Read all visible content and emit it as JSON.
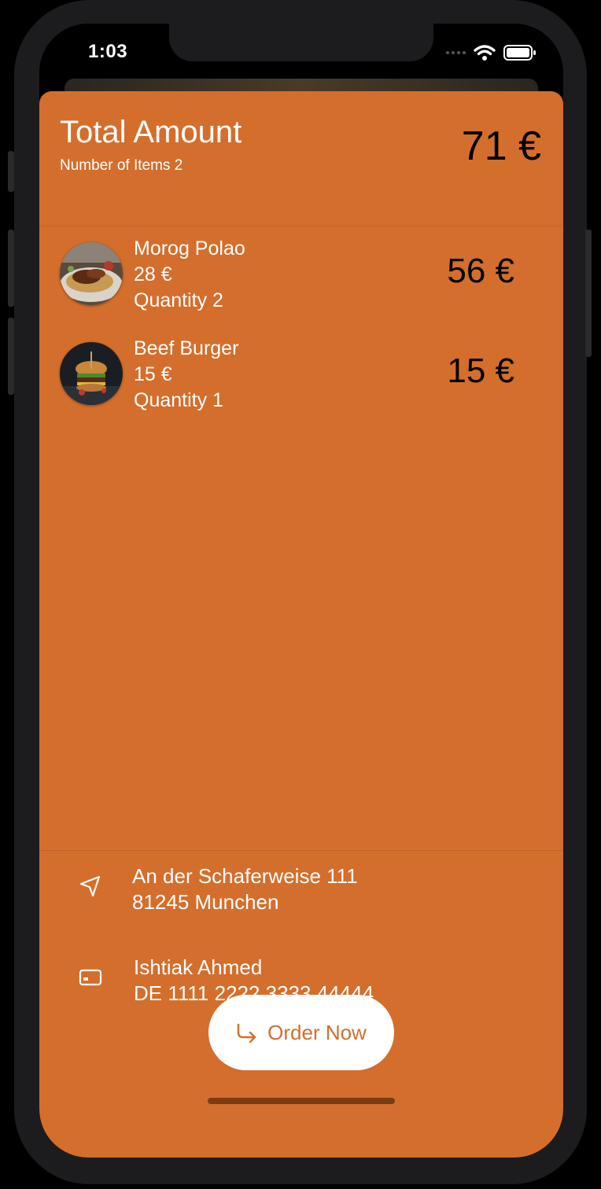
{
  "status_bar": {
    "time": "1:03"
  },
  "header": {
    "title": "Total Amount",
    "items_count": "Number of Items 2",
    "total": "71 €"
  },
  "cart_items": [
    {
      "name": "Morog Polao",
      "unit_price": "28 €",
      "quantity": "Quantity 2",
      "line_total": "56 €",
      "image": "rice-dish-photo"
    },
    {
      "name": "Beef Burger",
      "unit_price": "15 €",
      "quantity": "Quantity 1",
      "line_total": "15 €",
      "image": "burger-photo"
    }
  ],
  "address": {
    "icon": "navigation-arrow-icon",
    "line1": "An der Schaferweise 111",
    "line2": "81245 Munchen"
  },
  "payment": {
    "icon": "credit-card-icon",
    "name": "Ishtiak Ahmed",
    "iban": "DE 1111 2222 3333 44444"
  },
  "order_button": {
    "label": "Order Now",
    "icon": "redo-arrow-icon"
  },
  "colors": {
    "accent": "#d46e2c",
    "background": "#000000",
    "button": "#ffffff"
  }
}
